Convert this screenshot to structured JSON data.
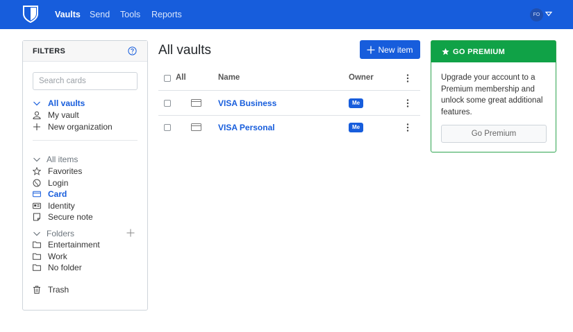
{
  "nav": {
    "links": [
      "Vaults",
      "Send",
      "Tools",
      "Reports"
    ],
    "active": "Vaults",
    "avatar_initials": "FO",
    "brand_color": "#175ddc"
  },
  "filters": {
    "title": "FILTERS",
    "search_placeholder": "Search cards",
    "vaults": {
      "header": "All vaults",
      "items": [
        "My vault",
        "New organization"
      ]
    },
    "types": {
      "header": "All items",
      "items": [
        "Favorites",
        "Login",
        "Card",
        "Identity",
        "Secure note"
      ],
      "selected": "Card"
    },
    "folders": {
      "header": "Folders",
      "items": [
        "Entertainment",
        "Work",
        "No folder"
      ]
    },
    "trash": "Trash"
  },
  "main": {
    "title": "All vaults",
    "new_item_label": "New item",
    "columns": {
      "all": "All",
      "name": "Name",
      "owner": "Owner"
    },
    "rows": [
      {
        "name": "VISA Business",
        "owner": "Me",
        "icon": "credit-card-icon"
      },
      {
        "name": "VISA Personal",
        "owner": "Me",
        "icon": "credit-card-icon"
      }
    ]
  },
  "premium": {
    "title": "GO PREMIUM",
    "text": "Upgrade your account to a Premium membership and unlock some great additional features.",
    "button_label": "Go Premium",
    "accent": "#10a247"
  }
}
